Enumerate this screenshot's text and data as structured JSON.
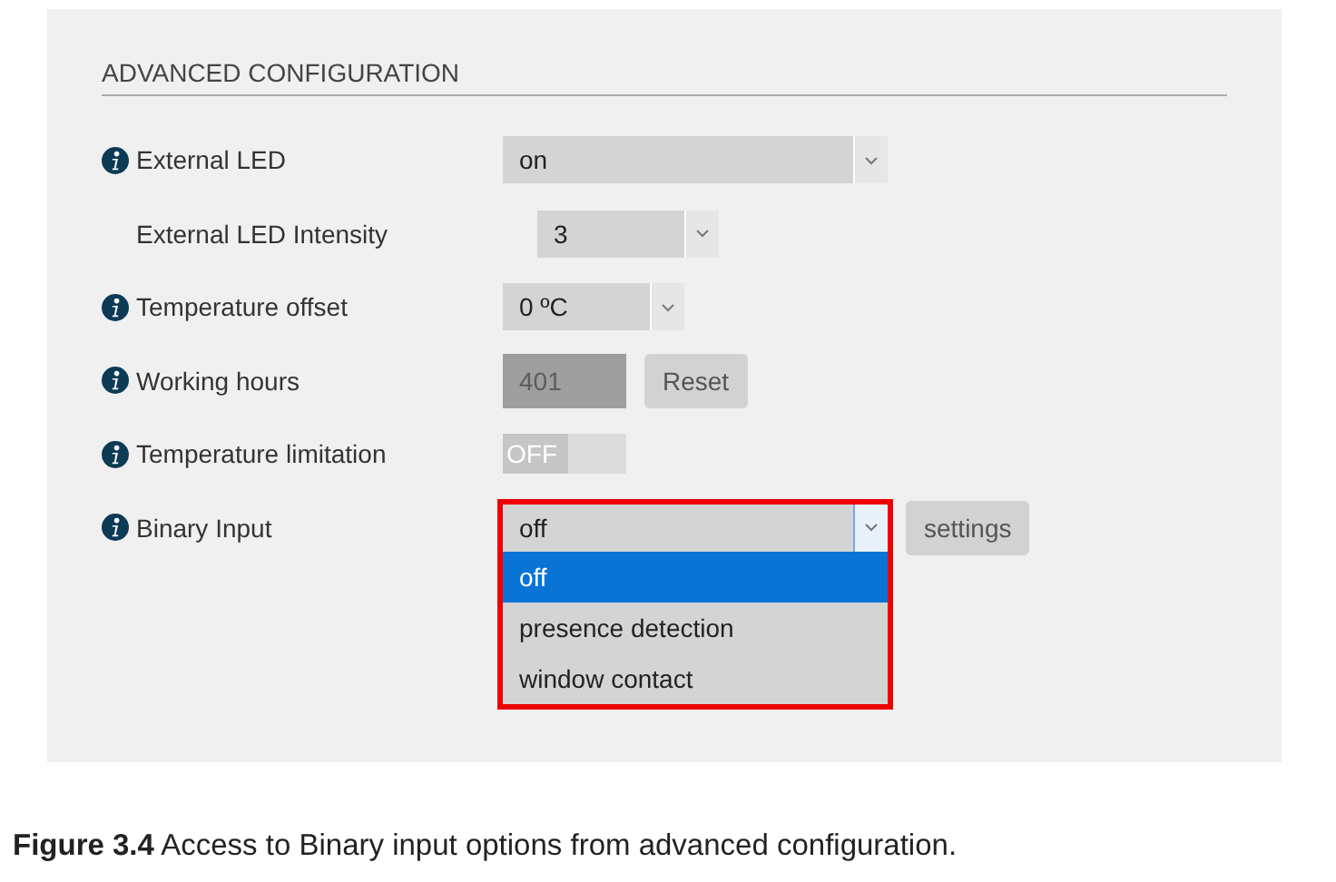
{
  "section": {
    "title": "ADVANCED CONFIGURATION"
  },
  "rows": [
    {
      "label": "External LED",
      "info": true,
      "kind": "wide-select",
      "value": "on",
      "children": [
        {
          "label": "External LED Intensity",
          "info": false,
          "kind": "select",
          "value": "3"
        }
      ]
    },
    {
      "label": "Temperature offset",
      "info": true,
      "kind": "select",
      "value": "0 ºC"
    },
    {
      "label": "Working hours",
      "info": true,
      "kind": "counter",
      "value": "401",
      "button": "Reset"
    },
    {
      "label": "Temperature limitation",
      "info": true,
      "kind": "toggle",
      "value": "OFF",
      "on": false
    },
    {
      "label": "Binary Input",
      "info": true,
      "kind": "wide-select",
      "value": "off",
      "button": "settings",
      "expanded": true,
      "highlighted": true,
      "options": [
        {
          "label": "off",
          "selected": true
        },
        {
          "label": "presence detection",
          "selected": false
        },
        {
          "label": "window contact",
          "selected": false
        }
      ]
    }
  ],
  "caption": "**Figure 3.4** Access to Binary input options from advanced configuration."
}
